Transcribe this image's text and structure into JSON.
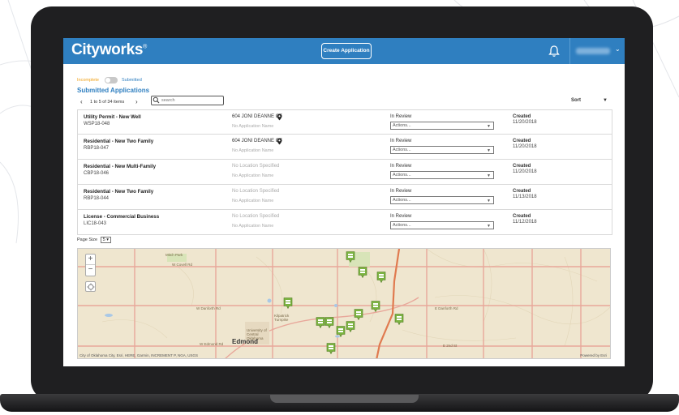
{
  "header": {
    "logo": "Cityworks",
    "logo_mark": "®",
    "create_button": "Create Application",
    "notifications_icon": "bell-icon",
    "user_menu_icon": "chevron-down-icon"
  },
  "toggle": {
    "incomplete_label": "Incomplete",
    "submitted_label": "Submitted"
  },
  "section_title": "Submitted Applications",
  "pager": {
    "prev": "‹",
    "text": "1 to 5 of 34 items",
    "next": "›",
    "search_placeholder": "search"
  },
  "sort": {
    "label": "Sort",
    "arrow": "▼"
  },
  "applications": [
    {
      "title": "Utility Permit - New Well",
      "id": "WSP18-048",
      "address": "604 JONI DEANNE CT",
      "has_pin": true,
      "name": "No Application Name",
      "status": "In Review",
      "actions": "Actions...",
      "created_label": "Created",
      "created_date": "11/20/2018"
    },
    {
      "title": "Residential - New Two Family",
      "id": "RBP18-047",
      "address": "604 JONI DEANNE CT",
      "has_pin": true,
      "name": "No Application Name",
      "status": "In Review",
      "actions": "Actions...",
      "created_label": "Created",
      "created_date": "11/20/2018"
    },
    {
      "title": "Residential - New Multi-Family",
      "id": "CBP18-046",
      "address": "No Location Specified",
      "has_pin": false,
      "name": "No Application Name",
      "status": "In Review",
      "actions": "Actions...",
      "created_label": "Created",
      "created_date": "11/20/2018"
    },
    {
      "title": "Residential - New Two Family",
      "id": "RBP18-044",
      "address": "No Location Specified",
      "has_pin": false,
      "name": "No Application Name",
      "status": "In Review",
      "actions": "Actions...",
      "created_label": "Created",
      "created_date": "11/13/2018"
    },
    {
      "title": "License - Commercial Business",
      "id": "LIC18-043",
      "address": "No Location Specified",
      "has_pin": false,
      "name": "No Application Name",
      "status": "In Review",
      "actions": "Actions...",
      "created_label": "Created",
      "created_date": "11/12/2018"
    }
  ],
  "page_size": {
    "label": "Page Size",
    "value": "5"
  },
  "map": {
    "zoom_in": "+",
    "zoom_out": "−",
    "city_label": "Edmond",
    "labels": [
      "Mitch Park",
      "W Covell Rd",
      "W Danforth Rd",
      "E Danforth Rd",
      "W Edmond Rd",
      "E 2nd St",
      "University of Central Oklahoma",
      "Kilpatrick Turnpike"
    ],
    "attribution": "City of Oklahoma City, Esri, HERE, Garmin, INCREMENT P, NGA, USGS",
    "powered_by": "Powered by Esri",
    "marker_color": "#7cb342",
    "road_color": "#e8a79a",
    "highway_color": "#e07a4f",
    "land_color": "#efe6cf"
  }
}
